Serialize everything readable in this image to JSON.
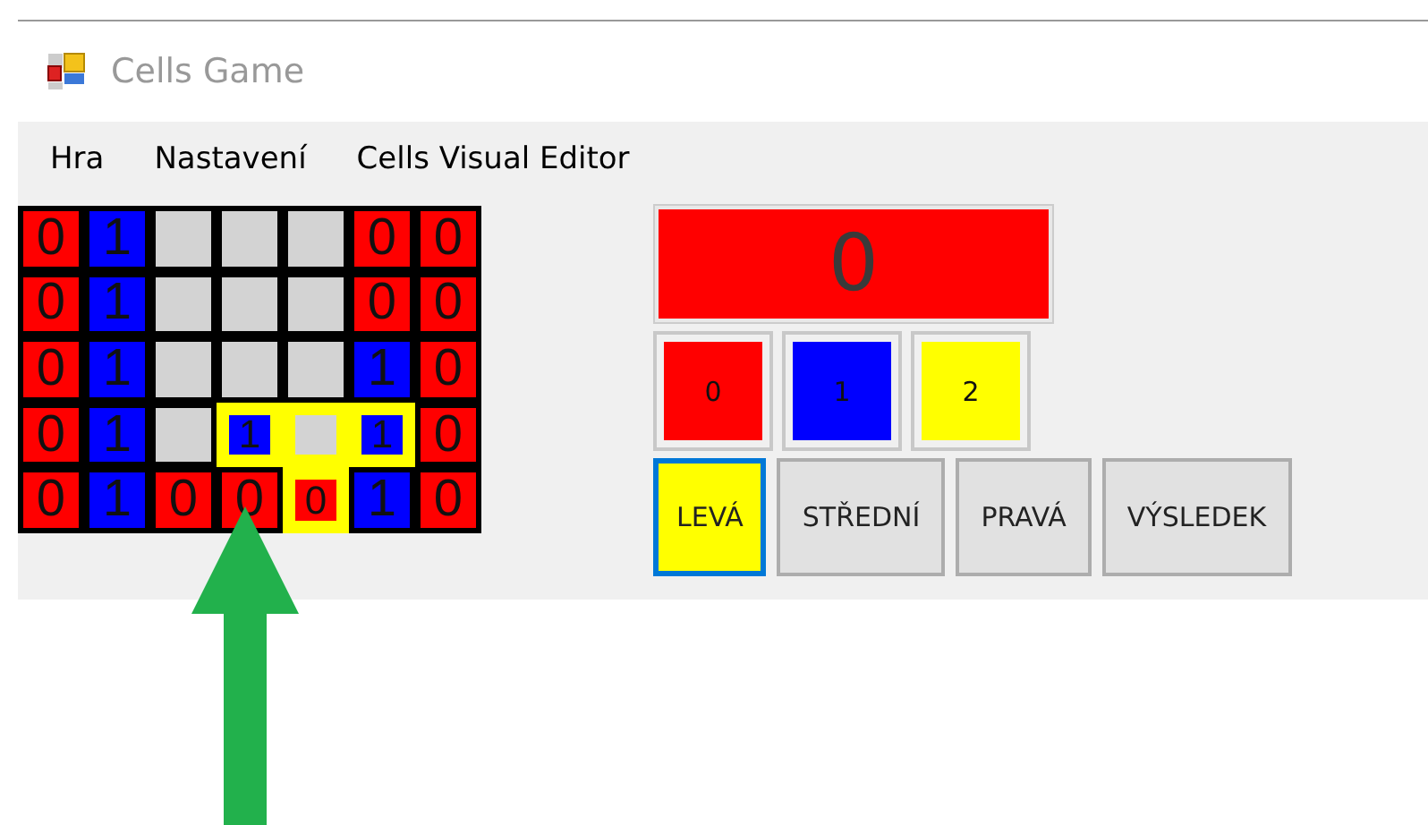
{
  "window": {
    "title": "Cells Game"
  },
  "menu": [
    "Hra",
    "Nastavení",
    "Cells Visual Editor"
  ],
  "grid": {
    "rows": [
      [
        {
          "value": "0",
          "color": "#ff0000",
          "highlighted": false
        },
        {
          "value": "1",
          "color": "#0000ff",
          "highlighted": false
        },
        {
          "color": "#d3d3d3",
          "highlighted": false
        },
        {
          "color": "#d3d3d3",
          "highlighted": false
        },
        {
          "color": "#d3d3d3",
          "highlighted": false
        },
        {
          "value": "0",
          "color": "#ff0000",
          "highlighted": false
        },
        {
          "value": "0",
          "color": "#ff0000",
          "highlighted": false
        }
      ],
      [
        {
          "value": "0",
          "color": "#ff0000",
          "highlighted": false
        },
        {
          "value": "1",
          "color": "#0000ff",
          "highlighted": false
        },
        {
          "color": "#d3d3d3",
          "highlighted": false
        },
        {
          "color": "#d3d3d3",
          "highlighted": false
        },
        {
          "color": "#d3d3d3",
          "highlighted": false
        },
        {
          "value": "0",
          "color": "#ff0000",
          "highlighted": false
        },
        {
          "value": "0",
          "color": "#ff0000",
          "highlighted": false
        }
      ],
      [
        {
          "value": "0",
          "color": "#ff0000",
          "highlighted": false
        },
        {
          "value": "1",
          "color": "#0000ff",
          "highlighted": false
        },
        {
          "color": "#d3d3d3",
          "highlighted": false
        },
        {
          "color": "#d3d3d3",
          "highlighted": false
        },
        {
          "color": "#d3d3d3",
          "highlighted": false
        },
        {
          "value": "1",
          "color": "#0000ff",
          "highlighted": false
        },
        {
          "value": "0",
          "color": "#ff0000",
          "highlighted": false
        }
      ],
      [
        {
          "value": "0",
          "color": "#ff0000",
          "highlighted": false
        },
        {
          "value": "1",
          "color": "#0000ff",
          "highlighted": false
        },
        {
          "color": "#d3d3d3",
          "highlighted": false
        },
        {
          "value": "1",
          "color": "#0000ff",
          "highlighted": true
        },
        {
          "color": "#d3d3d3",
          "highlighted": true
        },
        {
          "value": "1",
          "color": "#0000ff",
          "highlighted": true
        },
        {
          "value": "0",
          "color": "#ff0000",
          "highlighted": false
        }
      ],
      [
        {
          "value": "0",
          "color": "#ff0000",
          "highlighted": false
        },
        {
          "value": "1",
          "color": "#0000ff",
          "highlighted": false
        },
        {
          "value": "0",
          "color": "#ff0000",
          "highlighted": false
        },
        {
          "value": "0",
          "color": "#ff0000",
          "highlighted": false
        },
        {
          "value": "0",
          "color": "#ff0000",
          "highlighted": true
        },
        {
          "value": "1",
          "color": "#0000ff",
          "highlighted": false
        },
        {
          "value": "0",
          "color": "#ff0000",
          "highlighted": false
        }
      ]
    ]
  },
  "score": {
    "value": "0",
    "color": "#ff0000"
  },
  "palette": [
    {
      "label": "0",
      "color": "#ff0000"
    },
    {
      "label": "1",
      "color": "#0000ff"
    },
    {
      "label": "2",
      "color": "#ffff00"
    }
  ],
  "buttons": [
    {
      "label": "LEVÁ",
      "selected": true
    },
    {
      "label": "STŘEDNÍ",
      "selected": false
    },
    {
      "label": "PRAVÁ",
      "selected": false
    },
    {
      "label": "VÝSLEDEK",
      "selected": false
    }
  ]
}
